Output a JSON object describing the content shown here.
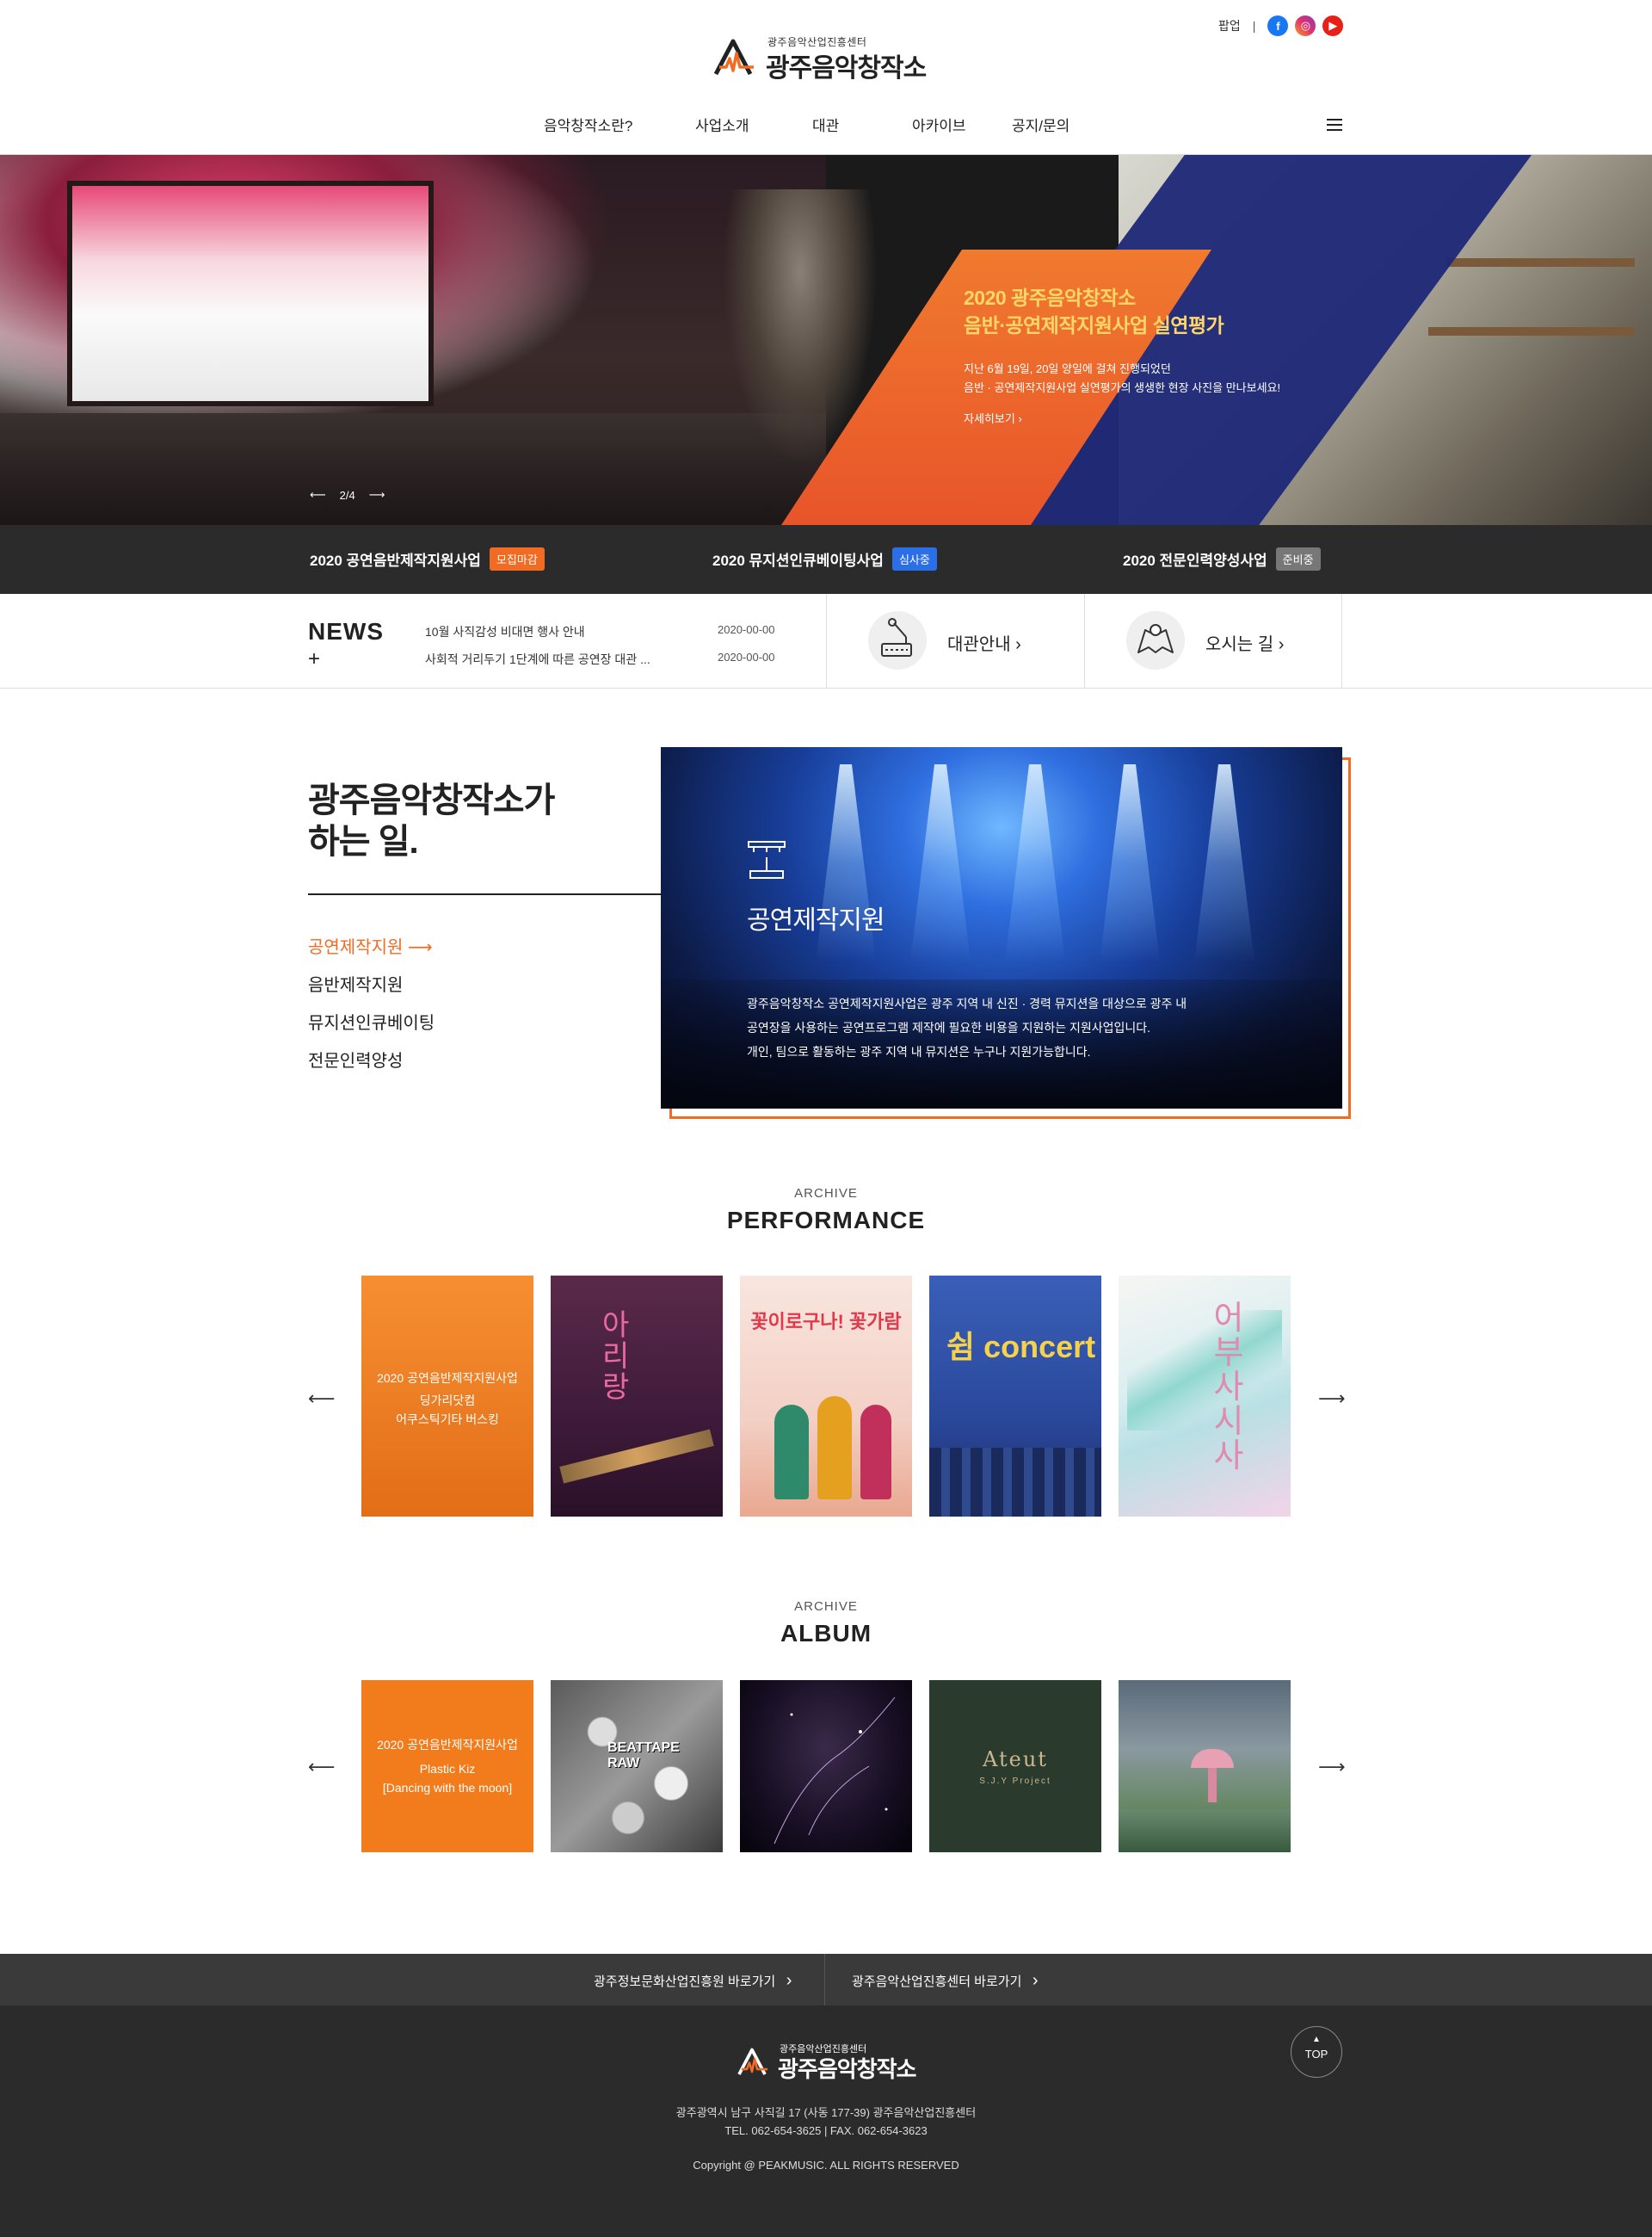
{
  "header": {
    "logo_sub": "광주음악산업진흥센터",
    "logo_main": "광주음악창작소",
    "popup_label": "팝업",
    "sns": [
      "facebook-icon",
      "instagram-icon",
      "youtube-icon"
    ]
  },
  "nav": {
    "items": [
      {
        "label": "음악창작소란?"
      },
      {
        "label": "사업소개"
      },
      {
        "label": "대관"
      },
      {
        "label": "아카이브"
      },
      {
        "label": "공지/문의"
      }
    ]
  },
  "hero": {
    "title_line1": "2020 광주음악창작소",
    "title_line2": "음반·공연제작지원사업 실연평가",
    "desc_line1": "지난 6월 19일, 20일 양일에 걸쳐 진행되었던",
    "desc_line2": "음반 · 공연제작지원사업 실연평가의 생생한 현장 사진을 만나보세요!",
    "more": "자세히보기",
    "more_icon": "›",
    "pager": "2/4"
  },
  "programs": [
    {
      "name": "2020 공연음반제작지원사업",
      "status": "모집마감",
      "color": "#f26b22"
    },
    {
      "name": "2020 뮤지션인큐베이팅사업",
      "status": "심사중",
      "color": "#2a6ee8"
    },
    {
      "name": "2020 전문인력양성사업",
      "status": "준비중",
      "color": "#777777"
    }
  ],
  "news": {
    "label": "NEWS",
    "plus": "+",
    "items": [
      {
        "title": "10월 사직감성 비대면 행사 안내",
        "date": "2020-00-00"
      },
      {
        "title": "사회적 거리두기 1단계에 따른 공연장 대관 ...",
        "date": "2020-00-00"
      }
    ]
  },
  "quick_links": [
    {
      "label": "대관안내",
      "icon": "mic-stand-icon"
    },
    {
      "label": "오시는 길",
      "icon": "map-icon"
    }
  ],
  "what": {
    "title_line1": "광주음악창작소가",
    "title_line2": "하는 일.",
    "menu": [
      "공연제작지원",
      "음반제작지원",
      "뮤지션인큐베이팅",
      "전문인력양성"
    ],
    "feature_title": "공연제작지원",
    "feature_desc_1": "광주음악창작소 공연제작지원사업은 광주 지역 내 신진 · 경력 뮤지션을 대상으로 광주 내",
    "feature_desc_2": "공연장을 사용하는 공연프로그램 제작에 필요한 비용을 지원하는 지원사업입니다.",
    "feature_desc_3": "개인, 팀으로 활동하는 광주 지역 내 뮤지션은 누구나 지원가능합니다."
  },
  "performance": {
    "sub": "ARCHIVE",
    "title": "PERFORMANCE",
    "first_caption_1": "2020 공연음반제작지원사업",
    "first_caption_2": "딩가리닷컴",
    "first_caption_3": "어쿠스틱기타 버스킹",
    "posters": [
      {
        "text": "아리랑"
      },
      {
        "text": "꽃이로구나! 꽃가람"
      },
      {
        "text": "쉼 concert"
      },
      {
        "text": "어부사시사"
      }
    ]
  },
  "album": {
    "sub": "ARCHIVE",
    "title": "ALBUM",
    "first_caption_1": "2020 공연음반제작지원사업",
    "first_caption_2": "Plastic Kiz",
    "first_caption_3": "[Dancing with the moon]",
    "covers": [
      {
        "text": "BEATTAPE RAW"
      },
      {
        "text": ""
      },
      {
        "text": "Ateut",
        "sub": "S.J.Y Project"
      },
      {
        "text": ""
      }
    ]
  },
  "footer": {
    "link1": "광주정보문화산업진흥원 바로가기",
    "link2": "광주음악산업진흥센터 바로가기",
    "chevron": "›",
    "logo_sub": "광주음악산업진흥센터",
    "logo_main": "광주음악창작소",
    "top": "TOP",
    "address": "광주광역시 남구 사직길 17 (사동 177-39) 광주음악산업진흥센터",
    "contact": "TEL. 062-654-3625 | FAX. 062-654-3623",
    "copyright": "Copyright @ PEAKMUSIC. ALL RIGHTS RESERVED"
  },
  "colors": {
    "accent": "#f26b22",
    "navy": "#1f2a78",
    "dark": "#2b2b2b"
  }
}
